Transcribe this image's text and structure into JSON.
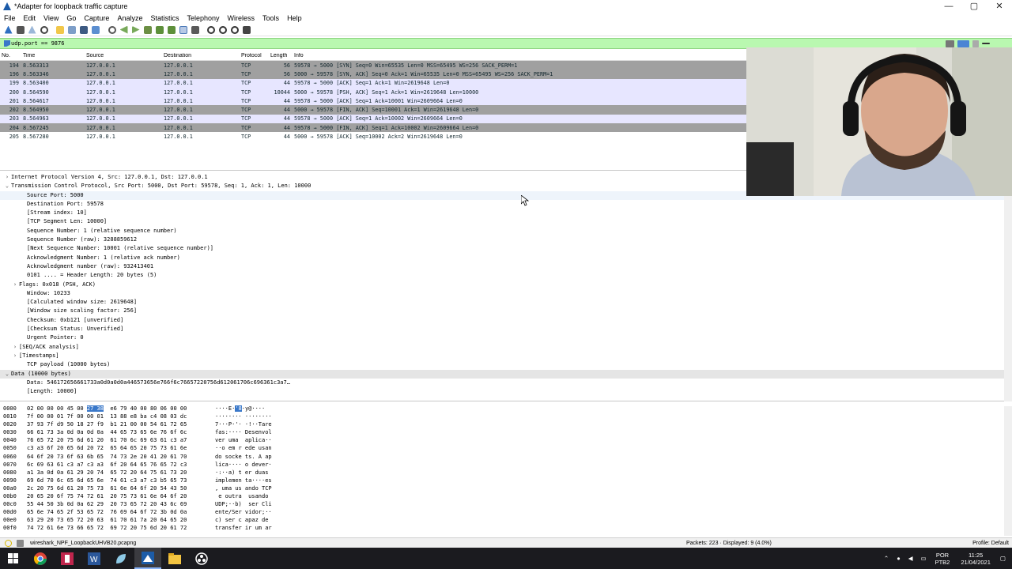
{
  "window": {
    "title": "*Adapter for loopback traffic capture",
    "controls": [
      "—",
      "▢",
      "✕"
    ]
  },
  "menu": [
    "File",
    "Edit",
    "View",
    "Go",
    "Capture",
    "Analyze",
    "Statistics",
    "Telephony",
    "Wireless",
    "Tools",
    "Help"
  ],
  "filter": {
    "value": "udp.port == 9876"
  },
  "packet_list": {
    "columns": [
      "No.",
      "Time",
      "Source",
      "Destination",
      "Protocol",
      "Length",
      "Info"
    ],
    "rows": [
      {
        "no": "194",
        "time": "8.563313",
        "src": "127.0.0.1",
        "dst": "127.0.0.1",
        "proto": "TCP",
        "len": "56",
        "info": "59578 → 5000 [SYN] Seq=0 Win=65535 Len=0 MSS=65495 WS=256 SACK_PERM=1",
        "style": "dark"
      },
      {
        "no": "196",
        "time": "8.563346",
        "src": "127.0.0.1",
        "dst": "127.0.0.1",
        "proto": "TCP",
        "len": "56",
        "info": "5000 → 59578 [SYN, ACK] Seq=0 Ack=1 Win=65535 Len=0 MSS=65495 WS=256 SACK_PERM=1",
        "style": "dark"
      },
      {
        "no": "199",
        "time": "8.563400",
        "src": "127.0.0.1",
        "dst": "127.0.0.1",
        "proto": "TCP",
        "len": "44",
        "info": "59578 → 5000 [ACK] Seq=1 Ack=1 Win=2619648 Len=0",
        "style": "light"
      },
      {
        "no": "200",
        "time": "8.564590",
        "src": "127.0.0.1",
        "dst": "127.0.0.1",
        "proto": "TCP",
        "len": "10044",
        "info": "5000 → 59578 [PSH, ACK] Seq=1 Ack=1 Win=2619648 Len=10000",
        "style": "light"
      },
      {
        "no": "201",
        "time": "8.564617",
        "src": "127.0.0.1",
        "dst": "127.0.0.1",
        "proto": "TCP",
        "len": "44",
        "info": "59578 → 5000 [ACK] Seq=1 Ack=10001 Win=2609664 Len=0",
        "style": "light"
      },
      {
        "no": "202",
        "time": "8.564950",
        "src": "127.0.0.1",
        "dst": "127.0.0.1",
        "proto": "TCP",
        "len": "44",
        "info": "5000 → 59578 [FIN, ACK] Seq=10001 Ack=1 Win=2619648 Len=0",
        "style": "dark"
      },
      {
        "no": "203",
        "time": "8.564963",
        "src": "127.0.0.1",
        "dst": "127.0.0.1",
        "proto": "TCP",
        "len": "44",
        "info": "59578 → 5000 [ACK] Seq=1 Ack=10002 Win=2609664 Len=0",
        "style": "light"
      },
      {
        "no": "204",
        "time": "8.567245",
        "src": "127.0.0.1",
        "dst": "127.0.0.1",
        "proto": "TCP",
        "len": "44",
        "info": "59578 → 5000 [FIN, ACK] Seq=1 Ack=10002 Win=2609664 Len=0",
        "style": "dark"
      },
      {
        "no": "205",
        "time": "8.567280",
        "src": "127.0.0.1",
        "dst": "127.0.0.1",
        "proto": "TCP",
        "len": "44",
        "info": "5000 → 59578 [ACK] Seq=10002 Ack=2 Win=2619648 Len=0",
        "style": "plain"
      }
    ]
  },
  "details": [
    {
      "indent": 0,
      "arrow": "›",
      "text": "Internet Protocol Version 4, Src: 127.0.0.1, Dst: 127.0.0.1",
      "style": ""
    },
    {
      "indent": 0,
      "arrow": "⌄",
      "text": "Transmission Control Protocol, Src Port: 5000, Dst Port: 59578, Seq: 1, Ack: 1, Len: 10000",
      "style": ""
    },
    {
      "indent": 2,
      "arrow": "",
      "text": "Source Port: 5000",
      "style": "hl"
    },
    {
      "indent": 2,
      "arrow": "",
      "text": "Destination Port: 59578",
      "style": ""
    },
    {
      "indent": 2,
      "arrow": "",
      "text": "[Stream index: 10]",
      "style": ""
    },
    {
      "indent": 2,
      "arrow": "",
      "text": "[TCP Segment Len: 10000]",
      "style": ""
    },
    {
      "indent": 2,
      "arrow": "",
      "text": "Sequence Number: 1    (relative sequence number)",
      "style": ""
    },
    {
      "indent": 2,
      "arrow": "",
      "text": "Sequence Number (raw): 3288859612",
      "style": ""
    },
    {
      "indent": 2,
      "arrow": "",
      "text": "[Next Sequence Number: 10001    (relative sequence number)]",
      "style": ""
    },
    {
      "indent": 2,
      "arrow": "",
      "text": "Acknowledgment Number: 1    (relative ack number)",
      "style": ""
    },
    {
      "indent": 2,
      "arrow": "",
      "text": "Acknowledgment number (raw): 932413401",
      "style": ""
    },
    {
      "indent": 2,
      "arrow": "",
      "text": "0101 .... = Header Length: 20 bytes (5)",
      "style": ""
    },
    {
      "indent": 1,
      "arrow": "›",
      "text": "Flags: 0x018 (PSH, ACK)",
      "style": ""
    },
    {
      "indent": 2,
      "arrow": "",
      "text": "Window: 10233",
      "style": ""
    },
    {
      "indent": 2,
      "arrow": "",
      "text": "[Calculated window size: 2619648]",
      "style": ""
    },
    {
      "indent": 2,
      "arrow": "",
      "text": "[Window size scaling factor: 256]",
      "style": ""
    },
    {
      "indent": 2,
      "arrow": "",
      "text": "Checksum: 0xb121 [unverified]",
      "style": ""
    },
    {
      "indent": 2,
      "arrow": "",
      "text": "[Checksum Status: Unverified]",
      "style": ""
    },
    {
      "indent": 2,
      "arrow": "",
      "text": "Urgent Pointer: 0",
      "style": ""
    },
    {
      "indent": 1,
      "arrow": "›",
      "text": "[SEQ/ACK analysis]",
      "style": ""
    },
    {
      "indent": 1,
      "arrow": "›",
      "text": "[Timestamps]",
      "style": ""
    },
    {
      "indent": 2,
      "arrow": "",
      "text": "TCP payload (10000 bytes)",
      "style": ""
    },
    {
      "indent": 0,
      "arrow": "⌄",
      "text": "Data (10000 bytes)",
      "style": "sel"
    },
    {
      "indent": 2,
      "arrow": "",
      "text": "Data: 546172656661733a0d0a0d0a446573656e766f6c76657220756d612061706c696361c3a7…",
      "style": ""
    },
    {
      "indent": 2,
      "arrow": "",
      "text": "[Length: 10000]",
      "style": ""
    }
  ],
  "bytes": [
    {
      "off": "0000",
      "hex_a": "02 00 00 00 45 00 ",
      "hex_sel": "27 38",
      "hex_b": "  e6 79 40 00 80 06 00 00",
      "asc_a": "····E·",
      "asc_sel": "'8",
      "asc_b": "·y@····"
    },
    {
      "off": "0010",
      "hex_a": "7f 00 00 01 7f 00 00 01  13 88 e8 ba c4 08 03 dc",
      "hex_sel": "",
      "hex_b": "",
      "asc_a": "········ ········",
      "asc_sel": "",
      "asc_b": ""
    },
    {
      "off": "0020",
      "hex_a": "37 93 7f d9 50 18 27 f9  b1 21 00 00 54 61 72 65",
      "hex_sel": "",
      "hex_b": "",
      "asc_a": "7···P·'· ·!··Tare",
      "asc_sel": "",
      "asc_b": ""
    },
    {
      "off": "0030",
      "hex_a": "66 61 73 3a 0d 0a 0d 0a  44 65 73 65 6e 76 6f 6c",
      "hex_sel": "",
      "hex_b": "",
      "asc_a": "fas:···· Desenvol",
      "asc_sel": "",
      "asc_b": ""
    },
    {
      "off": "0040",
      "hex_a": "76 65 72 20 75 6d 61 20  61 70 6c 69 63 61 c3 a7",
      "hex_sel": "",
      "hex_b": "",
      "asc_a": "ver uma  aplica··",
      "asc_sel": "",
      "asc_b": ""
    },
    {
      "off": "0050",
      "hex_a": "c3 a3 6f 20 65 6d 20 72  65 64 65 20 75 73 61 6e",
      "hex_sel": "",
      "hex_b": "",
      "asc_a": "··o em r ede usan",
      "asc_sel": "",
      "asc_b": ""
    },
    {
      "off": "0060",
      "hex_a": "64 6f 20 73 6f 63 6b 65  74 73 2e 20 41 20 61 70",
      "hex_sel": "",
      "hex_b": "",
      "asc_a": "do socke ts. A ap",
      "asc_sel": "",
      "asc_b": ""
    },
    {
      "off": "0070",
      "hex_a": "6c 69 63 61 c3 a7 c3 a3  6f 20 64 65 76 65 72 c3",
      "hex_sel": "",
      "hex_b": "",
      "asc_a": "lica···· o dever·",
      "asc_sel": "",
      "asc_b": ""
    },
    {
      "off": "0080",
      "hex_a": "a1 3a 0d 0a 61 29 20 74  65 72 20 64 75 61 73 20",
      "hex_sel": "",
      "hex_b": "",
      "asc_a": "·:··a) t er duas ",
      "asc_sel": "",
      "asc_b": ""
    },
    {
      "off": "0090",
      "hex_a": "69 6d 70 6c 65 6d 65 6e  74 61 c3 a7 c3 b5 65 73",
      "hex_sel": "",
      "hex_b": "",
      "asc_a": "implemen ta····es",
      "asc_sel": "",
      "asc_b": ""
    },
    {
      "off": "00a0",
      "hex_a": "2c 20 75 6d 61 20 75 73  61 6e 64 6f 20 54 43 50",
      "hex_sel": "",
      "hex_b": "",
      "asc_a": ", uma us ando TCP",
      "asc_sel": "",
      "asc_b": ""
    },
    {
      "off": "00b0",
      "hex_a": "20 65 20 6f 75 74 72 61  20 75 73 61 6e 64 6f 20",
      "hex_sel": "",
      "hex_b": "",
      "asc_a": " e outra  usando ",
      "asc_sel": "",
      "asc_b": ""
    },
    {
      "off": "00c0",
      "hex_a": "55 44 50 3b 0d 0a 62 29  20 73 65 72 20 43 6c 69",
      "hex_sel": "",
      "hex_b": "",
      "asc_a": "UDP;··b)  ser Cli",
      "asc_sel": "",
      "asc_b": ""
    },
    {
      "off": "00d0",
      "hex_a": "65 6e 74 65 2f 53 65 72  76 69 64 6f 72 3b 0d 0a",
      "hex_sel": "",
      "hex_b": "",
      "asc_a": "ente/Ser vidor;··",
      "asc_sel": "",
      "asc_b": ""
    },
    {
      "off": "00e0",
      "hex_a": "63 29 20 73 65 72 20 63  61 70 61 7a 20 64 65 20",
      "hex_sel": "",
      "hex_b": "",
      "asc_a": "c) ser c apaz de ",
      "asc_sel": "",
      "asc_b": ""
    },
    {
      "off": "00f0",
      "hex_a": "74 72 61 6e 73 66 65 72  69 72 20 75 6d 20 61 72",
      "hex_sel": "",
      "hex_b": "",
      "asc_a": "transfer ir um ar",
      "asc_sel": "",
      "asc_b": ""
    }
  ],
  "status": {
    "file": "wireshark_NPF_LoopbackUHVB20.pcapng",
    "packets": "Packets: 223 · Displayed: 9 (4.0%)",
    "profile": "Profile: Default"
  },
  "taskbar": {
    "lang": "POR",
    "lang2": "PTB2",
    "time": "11:25",
    "date": "21/04/2021"
  },
  "colors": {
    "filter_bg": "#b9f8b0",
    "row_dark": "#a0a0a0",
    "row_light": "#e7e6ff",
    "selection": "#3a78c9",
    "taskbar": "#1b1b1f"
  }
}
